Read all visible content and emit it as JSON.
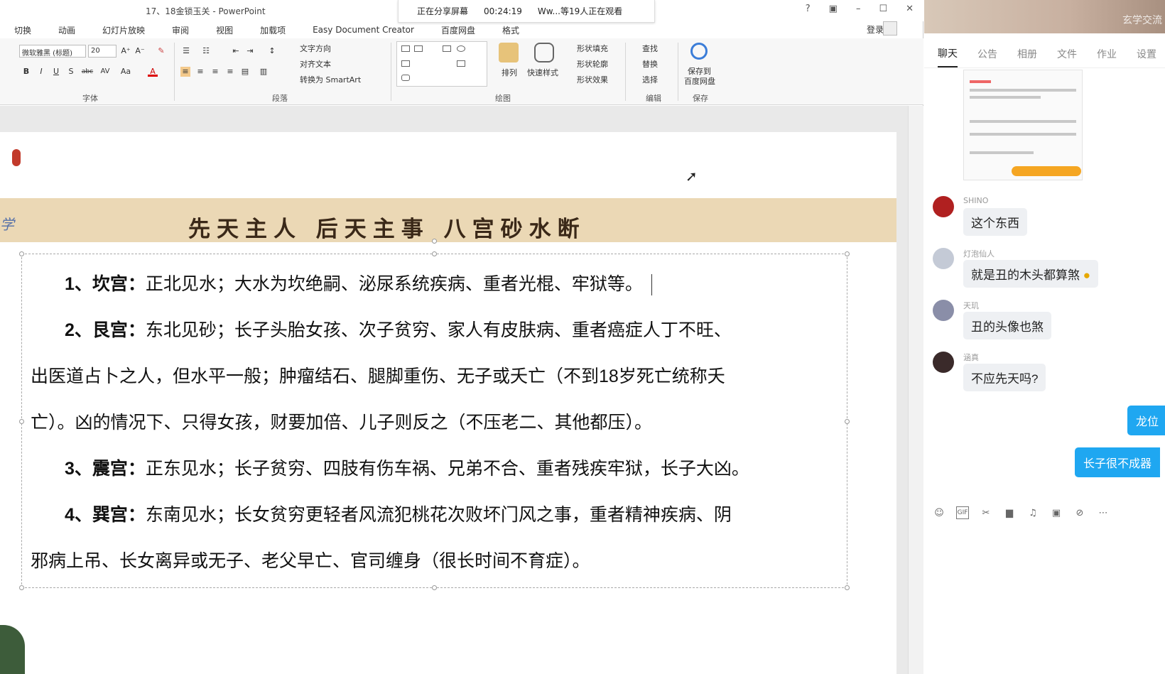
{
  "window": {
    "title": "17、18金锁玉关 - PowerPoint",
    "controls": [
      "?",
      "▣",
      "–",
      "☐",
      "✕"
    ]
  },
  "share": {
    "status": "正在分享屏幕",
    "timer": "00:24:19",
    "viewers": "Ww...等19人正在观看"
  },
  "ribbon_tabs": [
    "切换",
    "动画",
    "幻灯片放映",
    "审阅",
    "视图",
    "加载项",
    "Easy Document Creator",
    "百度网盘",
    "格式"
  ],
  "login": "登录",
  "ribbon": {
    "font_name": "微软雅黑 (标题)",
    "font_size": "20",
    "font_group": "字体",
    "paragraph_group": "段落",
    "drawing_group": "绘图",
    "edit_group": "编辑",
    "save_group": "保存",
    "text_direction": "文字方向",
    "align_text": "对齐文本",
    "convert_smartart": "转换为 SmartArt",
    "arrange": "排列",
    "quick_styles": "快速样式",
    "shape_fill": "形状填充",
    "shape_outline": "形状轮廓",
    "shape_effects": "形状效果",
    "find": "查找",
    "replace": "替换",
    "select": "选择",
    "save_to_baidu": "保存到",
    "save_to_baidu_2": "百度网盘",
    "bold": "B",
    "italic": "I",
    "underline": "U",
    "shadow": "S",
    "strikethrough": "abc",
    "spacing": "AV",
    "change_case": "Aa",
    "font_color": "A"
  },
  "slide": {
    "banner_title": "先天主人  后天主事  八宫砂水断",
    "side_glyph": "学",
    "paragraphs": [
      {
        "label": "1、坎宫：",
        "text": "正北见水；大水为坎绝嗣、泌尿系统疾病、重者光棍、牢狱等。"
      },
      {
        "label": "2、艮宫：",
        "text": "东北见砂；长子头胎女孩、次子贫穷、家人有皮肤病、重者癌症人丁不旺、",
        "cont": [
          "出医道占卜之人，但水平一般；肿瘤结石、腿脚重伤、无子或夭亡（不到18岁死亡统称夭",
          "亡）。凶的情况下、只得女孩，财要加倍、儿子则反之（不压老二、其他都压）。"
        ]
      },
      {
        "label": "3、震宫：",
        "text": "正东见水；长子贫穷、四肢有伤车祸、兄弟不合、重者残疾牢狱，长子大凶。"
      },
      {
        "label": "4、巽宫：",
        "text": "东南见水；长女贫穷更轻者风流犯桃花次败坏门风之事，重者精神疾病、阴",
        "cont": [
          "邪病上吊、长女离异或无子、老父早亡、官司缠身（很长时间不育症）。"
        ]
      }
    ]
  },
  "chat": {
    "header_text": "玄学交流",
    "tabs": [
      "聊天",
      "公告",
      "相册",
      "文件",
      "作业",
      "设置"
    ],
    "messages": [
      {
        "name": "SHINO",
        "text": "这个东西"
      },
      {
        "name": "灯泡仙人",
        "text": "就是丑的木头都算煞"
      },
      {
        "name": "天玑",
        "text": "丑的头像也煞"
      },
      {
        "name": "涵真",
        "text": "不应先天吗?"
      }
    ],
    "own_messages": [
      "龙位",
      "长子很不成器"
    ],
    "toolbar_icons": [
      "emoji-icon",
      "gif-icon",
      "scissors-icon",
      "folder-icon",
      "music-icon",
      "image-icon",
      "mute-icon",
      "more-icon"
    ]
  }
}
